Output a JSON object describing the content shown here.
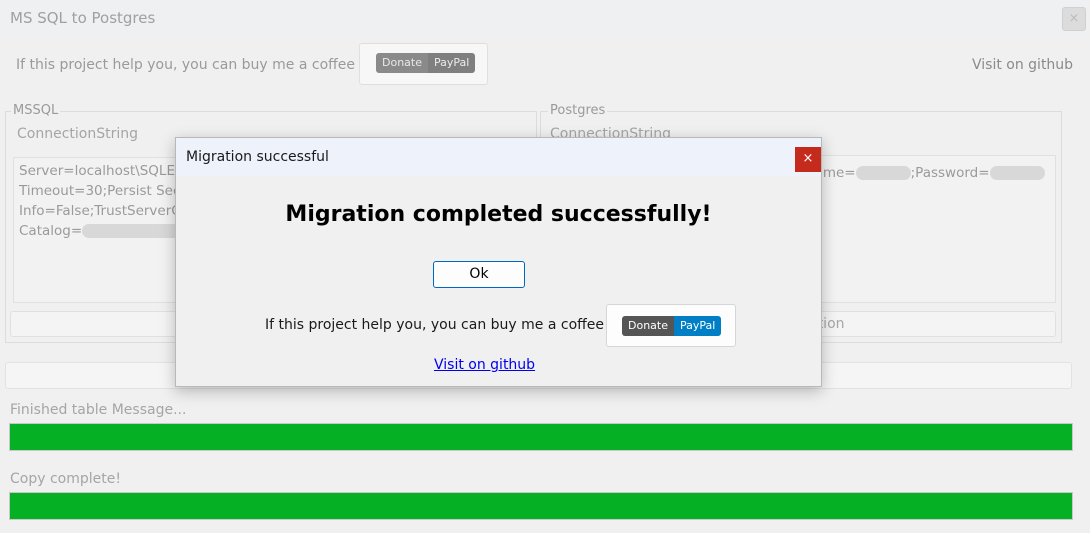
{
  "window": {
    "title": "MS SQL to Postgres",
    "close_glyph": "×"
  },
  "header": {
    "coffee_text": "If this project help you, you can buy me a coffee :)",
    "donate_left": "Donate",
    "donate_right": "PayPal",
    "visit_link": "Visit on github"
  },
  "mssql": {
    "legend": "MSSQL",
    "label": "ConnectionString",
    "lines": [
      "Server=localhost\\SQLEx",
      "Timeout=30;Persist Secu",
      "Info=False;TrustServerCe",
      "Catalog="
    ]
  },
  "postgres": {
    "legend": "Postgres",
    "label": "ConnectionString",
    "line_part1": "name=",
    "line_part2": ";Password=",
    "test_button_visible_text": "ction"
  },
  "status": {
    "table_message": "Finished table Message...",
    "table_progress": 1.0,
    "copy_message": "Copy complete!",
    "copy_progress": 1.0
  },
  "dialog": {
    "title": "Migration successful",
    "close_glyph": "×",
    "message": "Migration completed successfully!",
    "ok_label": "Ok",
    "coffee_text": "If this project help you, you can buy me a coffee :)",
    "donate_left": "Donate",
    "donate_right": "PayPal",
    "github_link": "Visit on github"
  },
  "colors": {
    "progress_fill": "#06b025",
    "dialog_close_bg": "#c42b1c",
    "link": "#0000ee",
    "ok_border": "#0067c0"
  },
  "icons": {
    "close": "close-icon",
    "dialog_close": "close-icon"
  }
}
